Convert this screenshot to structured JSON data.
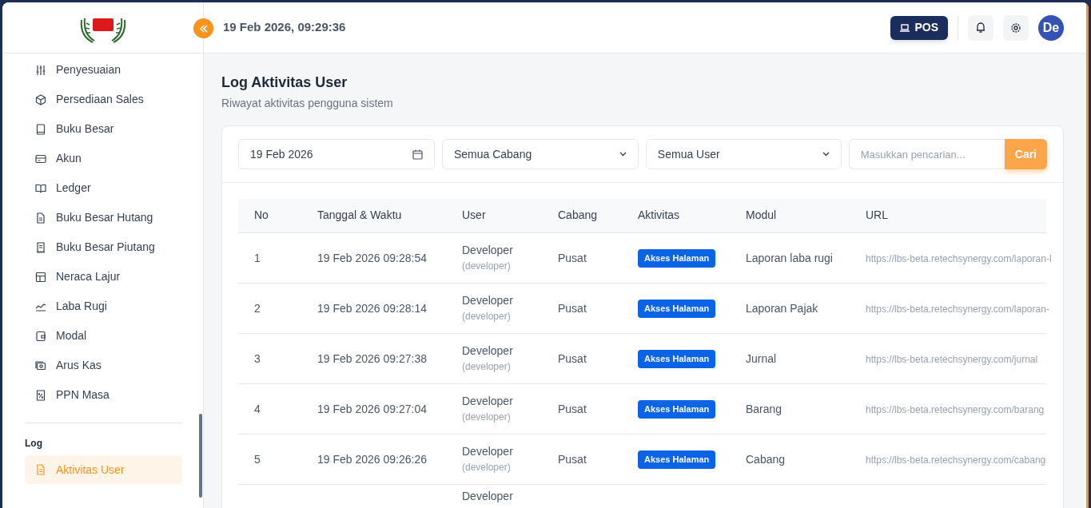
{
  "header": {
    "datetime": "19 Feb 2026, 09:29:36",
    "pos_button": "POS",
    "avatar": "De"
  },
  "sidebar": {
    "items": [
      {
        "label": "Penyesuaian",
        "selected": false
      },
      {
        "label": "Persediaan Sales",
        "selected": false
      },
      {
        "label": "Buku Besar",
        "selected": false
      },
      {
        "label": "Akun",
        "selected": false
      },
      {
        "label": "Ledger",
        "selected": false
      },
      {
        "label": "Buku Besar Hutang",
        "selected": false
      },
      {
        "label": "Buku Besar Piutang",
        "selected": false
      },
      {
        "label": "Neraca Lajur",
        "selected": false
      },
      {
        "label": "Laba Rugi",
        "selected": false
      },
      {
        "label": "Modal",
        "selected": false
      },
      {
        "label": "Arus Kas",
        "selected": false
      },
      {
        "label": "PPN Masa",
        "selected": false
      }
    ],
    "section": "Log",
    "section_items": [
      {
        "label": "Aktivitas User",
        "selected": true
      }
    ]
  },
  "page": {
    "title": "Log Aktivitas User",
    "subtitle": "Riwayat aktivitas pengguna sistem"
  },
  "filters": {
    "date": "19 Feb 2026",
    "branch": "Semua Cabang",
    "user": "Semua User",
    "search_placeholder": "Masukkan pencarian...",
    "search_button": "Cari"
  },
  "table": {
    "columns": [
      "No",
      "Tanggal & Waktu",
      "User",
      "Cabang",
      "Aktivitas",
      "Modul",
      "URL"
    ],
    "rows": [
      {
        "no": "1",
        "datetime": "19 Feb 2026 09:28:54",
        "user": "Developer",
        "username": "(developer)",
        "branch": "Pusat",
        "activity": "Akses Halaman",
        "module": "Laporan laba rugi",
        "url": "https://lbs-beta.retechsynergy.com/laporan-l"
      },
      {
        "no": "2",
        "datetime": "19 Feb 2026 09:28:14",
        "user": "Developer",
        "username": "(developer)",
        "branch": "Pusat",
        "activity": "Akses Halaman",
        "module": "Laporan Pajak",
        "url": "https://lbs-beta.retechsynergy.com/laporan-"
      },
      {
        "no": "3",
        "datetime": "19 Feb 2026 09:27:38",
        "user": "Developer",
        "username": "(developer)",
        "branch": "Pusat",
        "activity": "Akses Halaman",
        "module": "Jurnal",
        "url": "https://lbs-beta.retechsynergy.com/jurnal"
      },
      {
        "no": "4",
        "datetime": "19 Feb 2026 09:27:04",
        "user": "Developer",
        "username": "(developer)",
        "branch": "Pusat",
        "activity": "Akses Halaman",
        "module": "Barang",
        "url": "https://lbs-beta.retechsynergy.com/barang"
      },
      {
        "no": "5",
        "datetime": "19 Feb 2026 09:26:26",
        "user": "Developer",
        "username": "(developer)",
        "branch": "Pusat",
        "activity": "Akses Halaman",
        "module": "Cabang",
        "url": "https://lbs-beta.retechsynergy.com/cabang"
      },
      {
        "user": "Developer"
      }
    ]
  }
}
